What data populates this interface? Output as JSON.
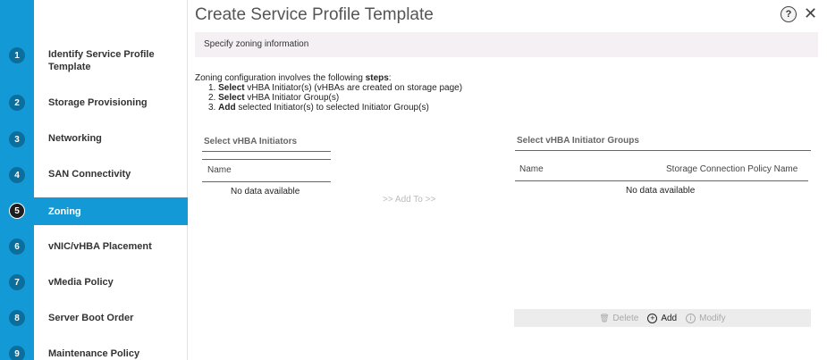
{
  "dialog": {
    "title": "Create Service Profile Template",
    "help_label": "?",
    "close_label": "✕"
  },
  "sidebar": {
    "items": [
      {
        "num": "1",
        "label": "Identify Service Profile Template"
      },
      {
        "num": "2",
        "label": "Storage Provisioning"
      },
      {
        "num": "3",
        "label": "Networking"
      },
      {
        "num": "4",
        "label": "SAN Connectivity"
      },
      {
        "num": "5",
        "label": "Zoning"
      },
      {
        "num": "6",
        "label": "vNIC/vHBA Placement"
      },
      {
        "num": "7",
        "label": "vMedia Policy"
      },
      {
        "num": "8",
        "label": "Server Boot Order"
      },
      {
        "num": "9",
        "label": "Maintenance Policy"
      }
    ],
    "active_index": 4
  },
  "subheader": "Specify zoning information",
  "intro": {
    "lead": "Zoning configuration involves the following ",
    "lead_bold": "steps",
    "lead_end": ":",
    "steps": [
      {
        "prefix": "1. ",
        "bold": "Select",
        "rest": " vHBA Initiator(s) (vHBAs are created on storage page)"
      },
      {
        "prefix": "2. ",
        "bold": "Select",
        "rest": " vHBA Initiator Group(s)"
      },
      {
        "prefix": "3. ",
        "bold": "Add",
        "rest": " selected Initiator(s) to selected Initiator Group(s)"
      }
    ]
  },
  "initiators": {
    "title": "Select vHBA Initiators",
    "col_name": "Name",
    "empty": "No data available"
  },
  "add_to_label": ">> Add To >>",
  "groups": {
    "title": "Select vHBA Initiator Groups",
    "col_name": "Name",
    "col_policy": "Storage Connection Policy Name",
    "empty": "No data available"
  },
  "actions": {
    "delete": "Delete",
    "add": "Add",
    "modify": "Modify"
  }
}
